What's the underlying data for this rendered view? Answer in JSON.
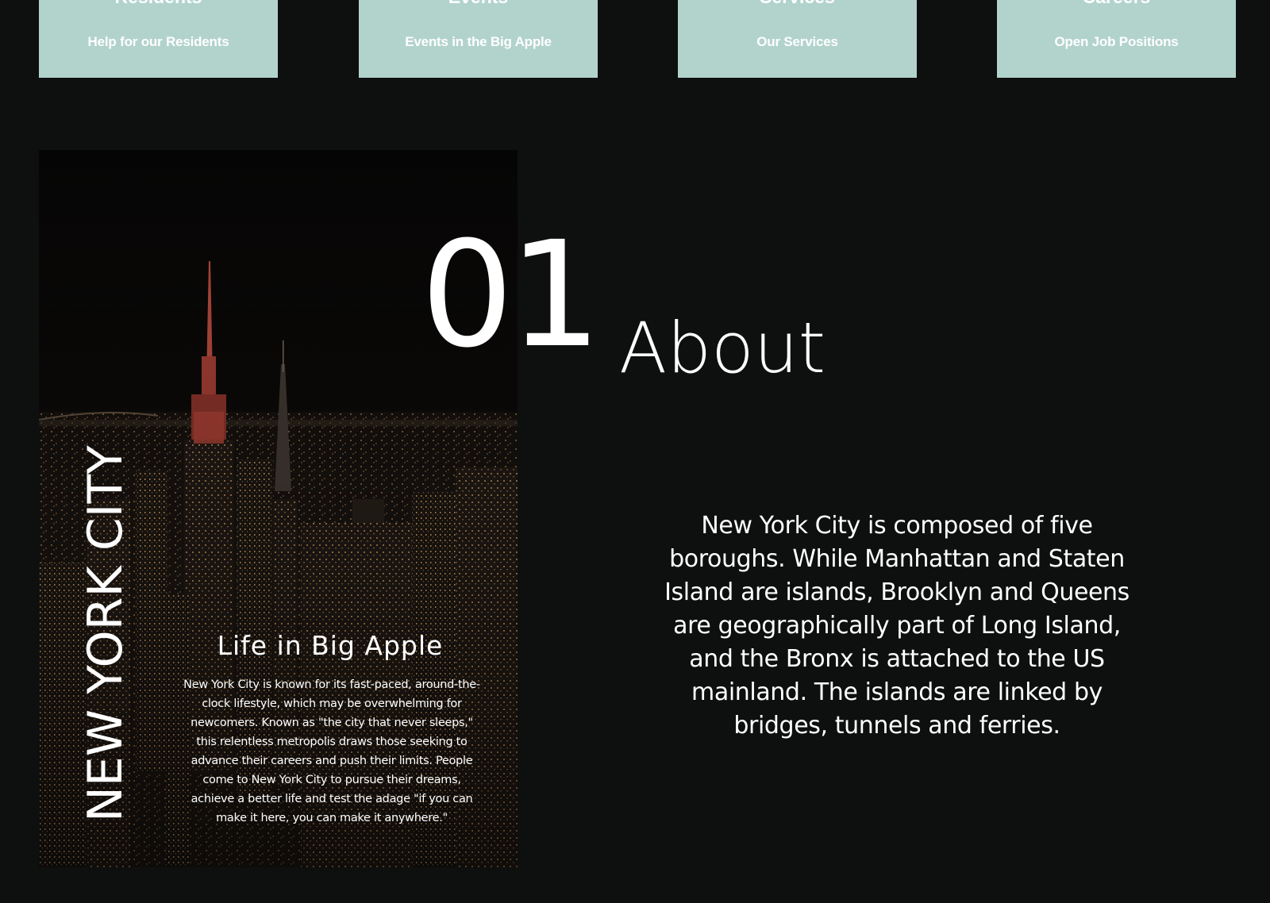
{
  "cards": [
    {
      "title": "Residents",
      "subtitle": "Help for our Residents"
    },
    {
      "title": "Events",
      "subtitle": "Events in the Big Apple"
    },
    {
      "title": "Services",
      "subtitle": "Our Services"
    },
    {
      "title": "Careers",
      "subtitle": "Open Job Positions"
    }
  ],
  "city_panel": {
    "vertical_title": "NEW YORK CITY",
    "caption_title": "Life in Big Apple",
    "caption_body": "New York City is known for its fast-paced, around-the-clock lifestyle, which may be overwhelming for newcomers. Known as \"the city that never sleeps,\" this relentless metropolis draws those seeking to advance their careers and push their limits. People come to New York City to pursue their dreams, achieve a better life and test the adage \"if you can make it here, you can make it anywhere.\""
  },
  "about": {
    "number": "01",
    "title": "About",
    "body": "New York City is composed of five boroughs. While Manhattan and Staten Island are islands, Brooklyn and Queens are geographically part of Long Island, and the Bronx is attached to the US mainland. The islands are linked by bridges, tunnels and ferries."
  },
  "colors": {
    "background": "#0e0f0f",
    "card": "#b2d3cc",
    "text": "#ffffff",
    "skyline_light": "#c6473a"
  }
}
